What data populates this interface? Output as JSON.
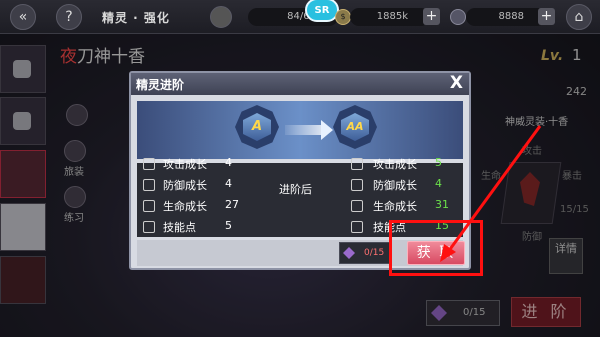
{
  "topbar": {
    "title": "精灵 · 强化",
    "stamina": "84/67",
    "gold": "1885k",
    "crystal": "8888",
    "logo": "SR"
  },
  "character": {
    "name_prefix": "夜",
    "name_rest": "刀神十香",
    "level_label": "Lv.",
    "level": "1",
    "stat_242": "242"
  },
  "side": {
    "label_xiuzheng": "旅装",
    "label_lianxi": "练习"
  },
  "right": {
    "equip_name": "神威灵装·十香",
    "attack": "攻击",
    "defense_hint": "暴击",
    "life": "生命",
    "attr_a": "防御",
    "attr_b": "15/15",
    "detail": "详情"
  },
  "bottom": {
    "counter": "0/15",
    "advance": "进 阶"
  },
  "popup": {
    "title": "精灵进阶",
    "close": "X",
    "rank_from": "A",
    "rank_to": "AA",
    "after_label": "进阶后",
    "before_stats": [
      {
        "label": "攻击成长",
        "value": "4"
      },
      {
        "label": "防御成长",
        "value": "4"
      },
      {
        "label": "生命成长",
        "value": "27"
      },
      {
        "label": "技能点",
        "value": "5"
      }
    ],
    "after_stats": [
      {
        "label": "攻击成长",
        "value": "5"
      },
      {
        "label": "防御成长",
        "value": "4"
      },
      {
        "label": "生命成长",
        "value": "31"
      },
      {
        "label": "技能点",
        "value": "15"
      }
    ],
    "material_count": "0/15",
    "get_button": "获 取"
  },
  "colors": {
    "highlight": "#ff1010",
    "improved": "#6be04a",
    "get_button": "#d84a62"
  }
}
